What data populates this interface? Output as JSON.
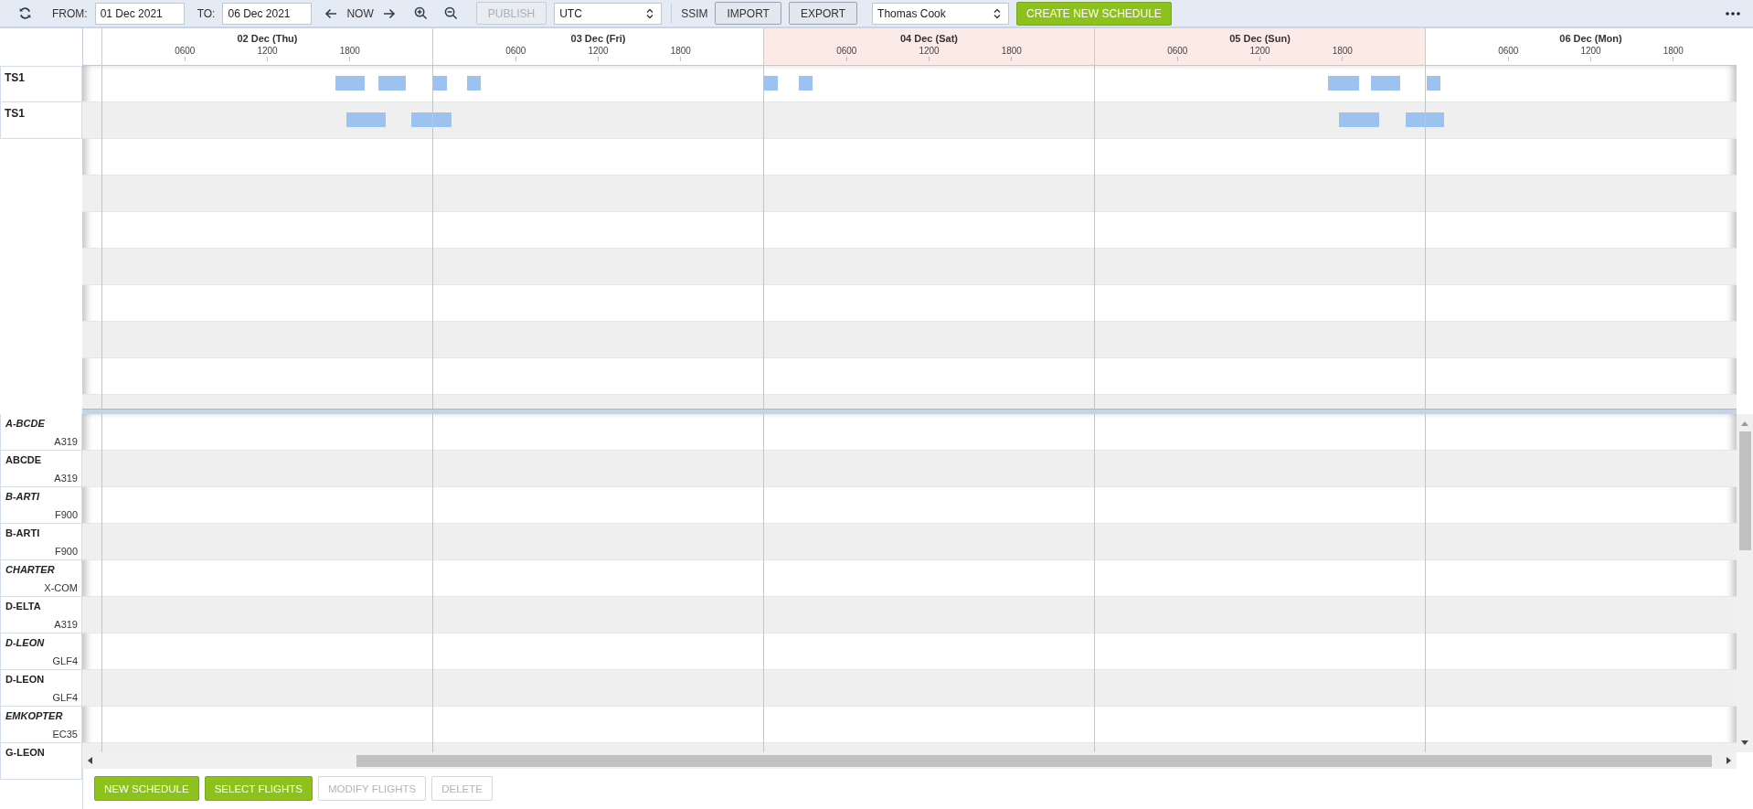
{
  "toolbar": {
    "from_label": "FROM:",
    "from_value": "01 Dec 2021",
    "to_label": "TO:",
    "to_value": "06 Dec 2021",
    "now_label": "NOW",
    "publish": {
      "label": "PUBLISH",
      "disabled": true
    },
    "timezone": "UTC",
    "ssim_label": "SSIM",
    "import": {
      "label": "IMPORT",
      "disabled": false
    },
    "export": {
      "label": "EXPORT",
      "disabled": false
    },
    "operator": "Thomas Cook",
    "create": {
      "label": "CREATE NEW SCHEDULE",
      "disabled": false
    }
  },
  "timeline": {
    "days": [
      {
        "label": "02 Dec (Thu)",
        "weekend": false,
        "ticks": [
          "0600",
          "1200",
          "1800"
        ]
      },
      {
        "label": "03 Dec (Fri)",
        "weekend": false,
        "ticks": [
          "0600",
          "1200",
          "1800"
        ]
      },
      {
        "label": "04 Dec (Sat)",
        "weekend": true,
        "ticks": [
          "0600",
          "1200",
          "1800"
        ]
      },
      {
        "label": "05 Dec (Sun)",
        "weekend": true,
        "ticks": [
          "0600",
          "1200",
          "1800"
        ]
      },
      {
        "label": "06 Dec (Mon)",
        "weekend": false,
        "ticks": [
          "0600",
          "1200",
          "1800"
        ]
      }
    ]
  },
  "schedules": [
    {
      "name": "TS1"
    },
    {
      "name": "TS1"
    }
  ],
  "aircraft": [
    {
      "registration": "A-BCDE",
      "type": "A319",
      "kind": "virtual"
    },
    {
      "registration": "ABCDE",
      "type": "A319",
      "kind": "registered"
    },
    {
      "registration": "B-ARTI",
      "type": "F900",
      "kind": "virtual"
    },
    {
      "registration": "B-ARTI",
      "type": "F900",
      "kind": "registered"
    },
    {
      "registration": "CHARTER",
      "type": "X-COM",
      "kind": "virtual"
    },
    {
      "registration": "D-ELTA",
      "type": "A319",
      "kind": "registered"
    },
    {
      "registration": "D-LEON",
      "type": "GLF4",
      "kind": "virtual"
    },
    {
      "registration": "D-LEON",
      "type": "GLF4",
      "kind": "registered"
    },
    {
      "registration": "EMKOPTER",
      "type": "EC35",
      "kind": "virtual"
    },
    {
      "registration": "G-LEON",
      "kind": "registered"
    }
  ],
  "actions": [
    {
      "label": "NEW SCHEDULE",
      "kind": "primary",
      "disabled": false
    },
    {
      "label": "SELECT FLIGHTS",
      "kind": "primary",
      "disabled": false
    },
    {
      "label": "MODIFY FLIGHTS",
      "kind": "secondary",
      "disabled": true
    },
    {
      "label": "DELETE",
      "kind": "secondary",
      "disabled": true
    }
  ]
}
